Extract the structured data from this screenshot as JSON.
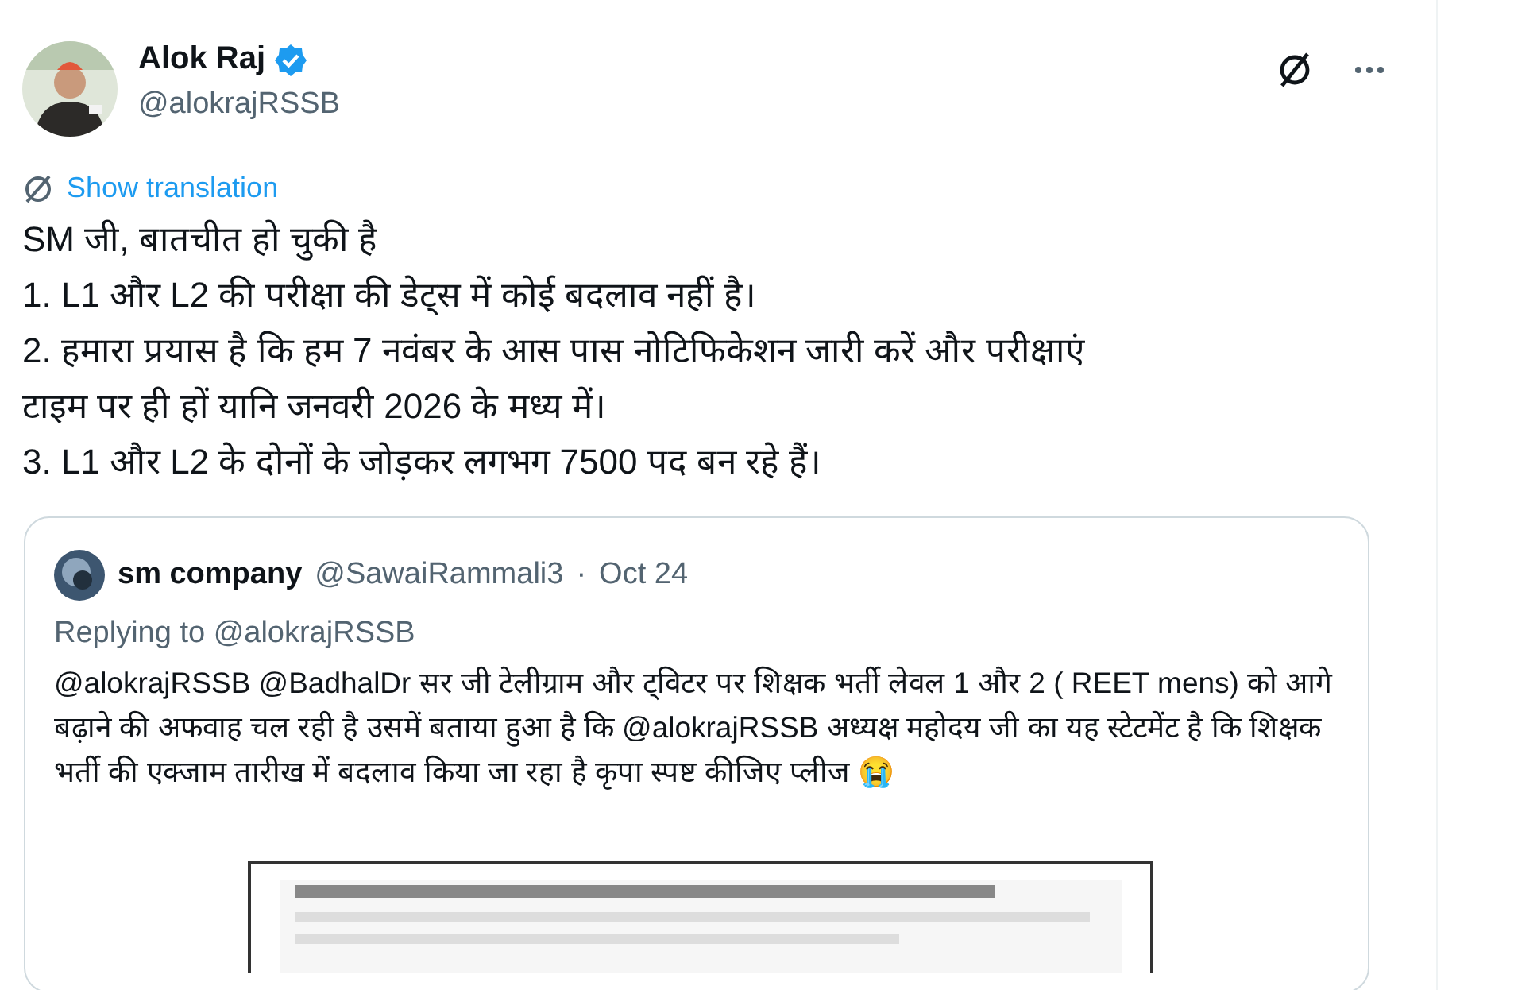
{
  "post": {
    "author": "Alok Raj",
    "verified": true,
    "handle": "@alokrajRSSB",
    "translate_label": "Show translation",
    "lines": [
      "SM जी, बातचीत हो चुकी है",
      "1. L1 और L2 की परीक्षा की डेट्स में कोई बदलाव नहीं है।",
      "2. हमारा प्रयास है कि हम 7 नवंबर के आस पास नोटिफिकेशन जारी करें और परीक्षाएं टाइम पर ही हों यानि जनवरी 2026 के मध्य में।",
      "3. L1 और L2 के दोनों के जोड़कर लगभग 7500 पद बन रहे हैं।"
    ]
  },
  "quote": {
    "author": "sm company",
    "handle": "@SawaiRammali3",
    "separator": "·",
    "date": "Oct 24",
    "replying_label": "Replying to",
    "replying_to": "@alokrajRSSB",
    "text": "@alokrajRSSB @BadhalDr  सर जी टेलीग्राम और ट्विटर पर शिक्षक भर्ती लेवल 1 और 2 ( REET mens) को आगे बढ़ाने की अफवाह चल रही है उसमें बताया हुआ है कि @alokrajRSSB अध्यक्ष महोदय जी का यह स्टेटमेंट है कि शिक्षक भर्ती की एक्जाम तारीख में बदलाव किया जा रहा है कृपा स्पष्ट कीजिए प्लीज 😭"
  }
}
